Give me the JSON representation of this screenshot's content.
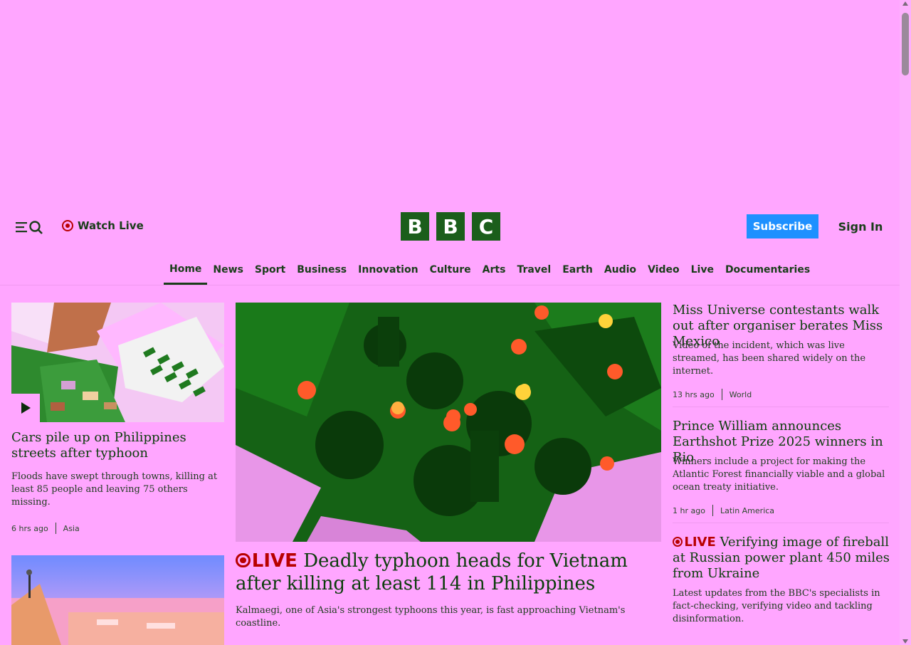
{
  "header": {
    "watch_live": "Watch Live",
    "logo_letters": [
      "B",
      "B",
      "C"
    ],
    "subscribe": "Subscribe",
    "sign_in": "Sign In",
    "brand_color": "#1b5e1b",
    "accent_color": "#1e90ff",
    "live_color": "#b80000"
  },
  "nav": {
    "items": [
      "Home",
      "News",
      "Sport",
      "Business",
      "Innovation",
      "Culture",
      "Arts",
      "Travel",
      "Earth",
      "Audio",
      "Video",
      "Live",
      "Documentaries"
    ],
    "active": "Home"
  },
  "stories": {
    "left1": {
      "headline": "Cars pile up on Philippines streets after typhoon",
      "summary": "Floods have swept through towns, killing at least 85 people and leaving 75 others missing.",
      "time": "6 hrs ago",
      "section": "Asia"
    },
    "main": {
      "live_label": "LIVE",
      "headline": "Deadly typhoon heads for Vietnam after killing at least 114 in Philippines",
      "summary": "Kalmaegi, one of Asia's strongest typhoons this year, is fast approaching Vietnam's coastline."
    },
    "right1": {
      "headline": "Miss Universe contestants walk out after organiser berates Miss Mexico",
      "summary": "Video of the incident, which was live streamed, has been shared widely on the internet.",
      "time": "13 hrs ago",
      "section": "World"
    },
    "right2": {
      "headline": "Prince William announces Earthshot Prize 2025 winners in Rio",
      "summary": "Winners include a project for making the Atlantic Forest financially viable and a global ocean treaty initiative.",
      "time": "1 hr ago",
      "section": "Latin America"
    },
    "right3": {
      "live_label": "LIVE",
      "headline": "Verifying image of fireball at Russian power plant 450 miles from Ukraine",
      "summary": "Latest updates from the BBC's specialists in fact-checking, verifying video and tackling disinformation."
    }
  }
}
